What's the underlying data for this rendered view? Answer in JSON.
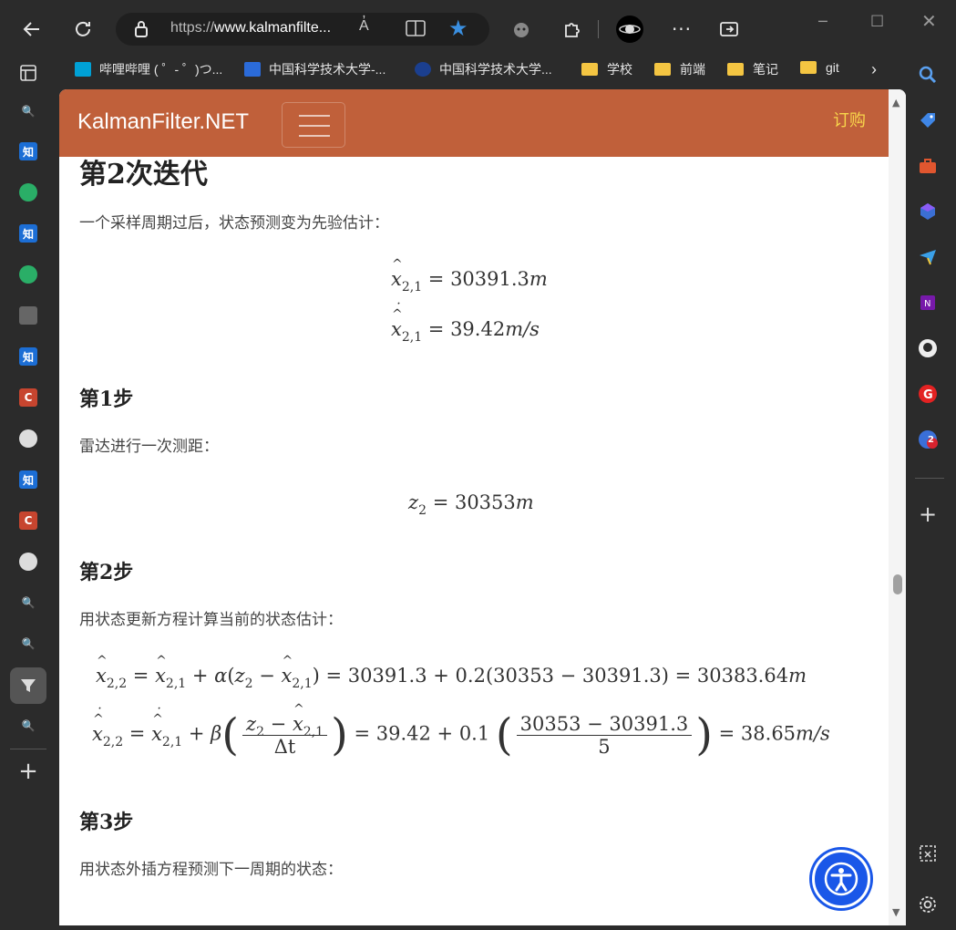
{
  "browser": {
    "url_prefix": "https://",
    "url_host": "www.kalmanfilte...",
    "read_aloud": "A̓",
    "bookmarks": [
      {
        "label": "哔哩哔哩 ( ゜- ゜)つ...",
        "icon": "bilibili-icon"
      },
      {
        "label": "中国科学技术大学-...",
        "icon": "ustc-icon"
      },
      {
        "label": "中国科学技术大学...",
        "icon": "ustc-seal-icon"
      },
      {
        "label": "学校",
        "icon": "folder-icon"
      },
      {
        "label": "前端",
        "icon": "folder-icon"
      },
      {
        "label": "笔记",
        "icon": "folder-icon"
      },
      {
        "label": "git",
        "icon": "folder-icon"
      }
    ],
    "left_sidebar_glyphs": {
      "zhihu": "知",
      "csdn": "C"
    },
    "right_badge": "2",
    "accent_color": "#3a8fe0"
  },
  "site": {
    "brand": "KalmanFilter.NET",
    "buy": "订购",
    "nav_color": "#c0603a"
  },
  "article": {
    "heading": "第2次迭代",
    "intro": "一个采样周期过后，状态预测变为先验估计：",
    "step1": {
      "title": "第1步",
      "text": "雷达进行一次测距："
    },
    "step2": {
      "title": "第2步",
      "text": "用状态更新方程计算当前的状态估计："
    },
    "step3": {
      "title": "第3步",
      "text": "用状态外插方程预测下一周期的状态："
    },
    "eq_pred_x": {
      "rhs": "= 30391.3",
      "unit": "m"
    },
    "eq_pred_v": {
      "rhs": "= 39.42",
      "unit": "m/s"
    },
    "eq_meas": {
      "rhs": "= 30353",
      "unit": "m"
    },
    "eq_update_x": {
      "part1": "+",
      "alpha": "α",
      "part2": "= 30391.3 + 0.2",
      "part3": "(30353 − 30391.3) = 30383.64",
      "unit": "m"
    },
    "eq_update_v": {
      "beta": "β",
      "den1": "Δt",
      "mid": "= 39.42 + 0.1",
      "num2": "30353 − 30391.3",
      "den2": "5",
      "result": "= 38.65",
      "unit": "m/s"
    }
  }
}
